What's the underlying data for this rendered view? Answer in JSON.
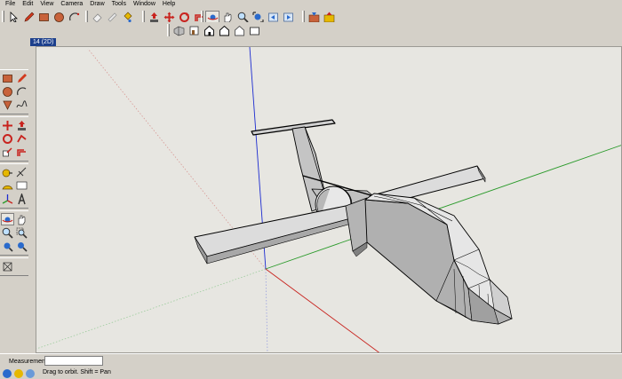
{
  "menu": [
    "File",
    "Edit",
    "View",
    "Camera",
    "Draw",
    "Tools",
    "Window",
    "Help"
  ],
  "scene_tab": "14 (2D)",
  "status": {
    "measurements_label": "Measurements",
    "measurements_value": "",
    "hint": "Drag to orbit.  Shift = Pan"
  },
  "colors": {
    "chrome": "#d4d0c8",
    "canvas": "#e7e6e1",
    "axis_red": "#c8231e",
    "axis_green": "#2a9a2a",
    "axis_blue": "#1c2bd0",
    "scene_tab": "#1c3f8c"
  },
  "toolbar_top": [
    "select-icon",
    "pencil-icon",
    "rectangle-icon",
    "circle-icon",
    "arc-icon",
    "eraser-icon",
    "tape-measure-icon",
    "paint-bucket-icon",
    "push-pull-icon",
    "move-icon",
    "rotate-icon",
    "offset-icon",
    "orbit-icon",
    "pan-icon",
    "zoom-icon",
    "zoom-extents-icon",
    "previous-view-icon",
    "next-view-icon",
    "get-models-icon",
    "share-model-icon"
  ],
  "toolbar_views": [
    "iso-view-icon",
    "top-view-icon",
    "front-view-icon",
    "right-view-icon",
    "back-view-icon",
    "left-view-icon"
  ],
  "status_icons": [
    "geo-location-icon",
    "credits-icon",
    "help-icon"
  ]
}
